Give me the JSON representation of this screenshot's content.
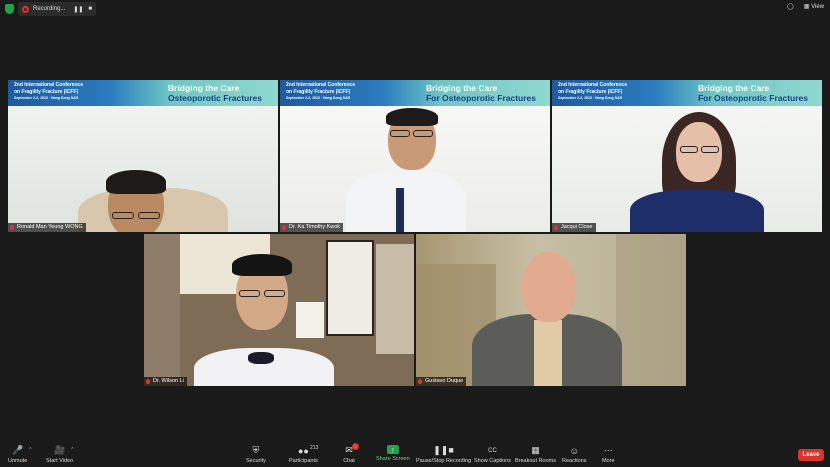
{
  "topbar": {
    "recording_label": "Recording...",
    "pause_icon": "pause-icon",
    "stop_icon": "stop-icon",
    "view_label": "View"
  },
  "banner": {
    "conf_line1": "2nd International Conference",
    "conf_line2": "on Fragility Fracture (ICFF)",
    "conf_line3": "September 2-3, 2023 · Hong Kong SAR",
    "title_line1": "Bridging the Care",
    "title_line2_a": "Osteoporotic Fractures",
    "title_line2_b": "For Osteoporotic Fractures"
  },
  "participants": [
    {
      "name": "Ronald Man Yeung WONG"
    },
    {
      "name": "Dr. Ka Timothy Kwok"
    },
    {
      "name": "Jacqui Close"
    },
    {
      "name": "Dr. Wilson Li"
    },
    {
      "name": "Gustavo Duque"
    }
  ],
  "toolbar": {
    "unmute": "Unmute",
    "start_video": "Start Video",
    "security": "Security",
    "participants": "Participants",
    "participants_count": "213",
    "chat": "Chat",
    "chat_badge": "1",
    "share_screen": "Share Screen",
    "recording": "Pause/Stop Recording",
    "captions": "Show Captions",
    "breakout": "Breakout Rooms",
    "reactions": "Reactions",
    "more": "More",
    "leave": "Leave"
  },
  "colors": {
    "accent_green": "#23a14b",
    "leave_red": "#d9352b",
    "banner_blue": "#1e5aa0",
    "banner_teal": "#8fd8cf"
  }
}
